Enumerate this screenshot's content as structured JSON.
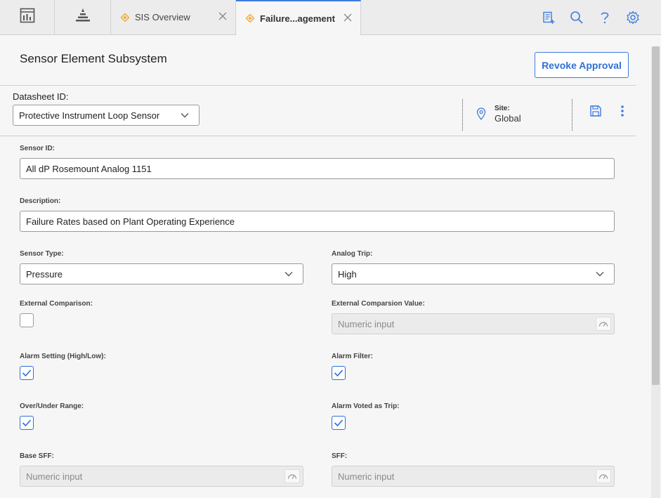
{
  "topbar": {
    "tabs": [
      {
        "label": "SIS Overview",
        "icon": "diamond-icon",
        "active": false
      },
      {
        "label": "Failure...agement",
        "icon": "diamond-icon",
        "active": true
      }
    ],
    "left_icons": [
      "dashboard-icon",
      "asset-hierarchy-icon"
    ],
    "right_icons": [
      "clipboard-add-icon",
      "search-icon",
      "help-icon",
      "gear-icon"
    ]
  },
  "header": {
    "title": "Sensor Element Subsystem",
    "revoke_label": "Revoke Approval",
    "datasheet_label": "Datasheet ID:",
    "datasheet_value": "Protective Instrument Loop Sensor",
    "site_label": "Site:",
    "site_value": "Global"
  },
  "form": {
    "sensor_id_label": "Sensor ID:",
    "sensor_id_value": "All dP Rosemount Analog 1151",
    "description_label": "Description:",
    "description_value": "Failure Rates based on Plant Operating Experience",
    "sensor_type_label": "Sensor Type:",
    "sensor_type_value": "Pressure",
    "analog_trip_label": "Analog Trip:",
    "analog_trip_value": "High",
    "external_comparison_label": "External Comparison:",
    "external_comparison_checked": false,
    "external_comparison_value_label": "External Comparsion Value:",
    "external_comparison_value_placeholder": "Numeric input",
    "alarm_setting_label": "Alarm Setting (High/Low):",
    "alarm_setting_checked": true,
    "alarm_filter_label": "Alarm Filter:",
    "alarm_filter_checked": true,
    "over_under_label": "Over/Under Range:",
    "over_under_checked": true,
    "alarm_voted_label": "Alarm Voted as Trip:",
    "alarm_voted_checked": true,
    "base_sff_label": "Base SFF:",
    "base_sff_placeholder": "Numeric input",
    "sff_label": "SFF:",
    "sff_placeholder": "Numeric input"
  },
  "colors": {
    "accent": "#2f6fd6",
    "tab_icon": "#f0a830"
  }
}
